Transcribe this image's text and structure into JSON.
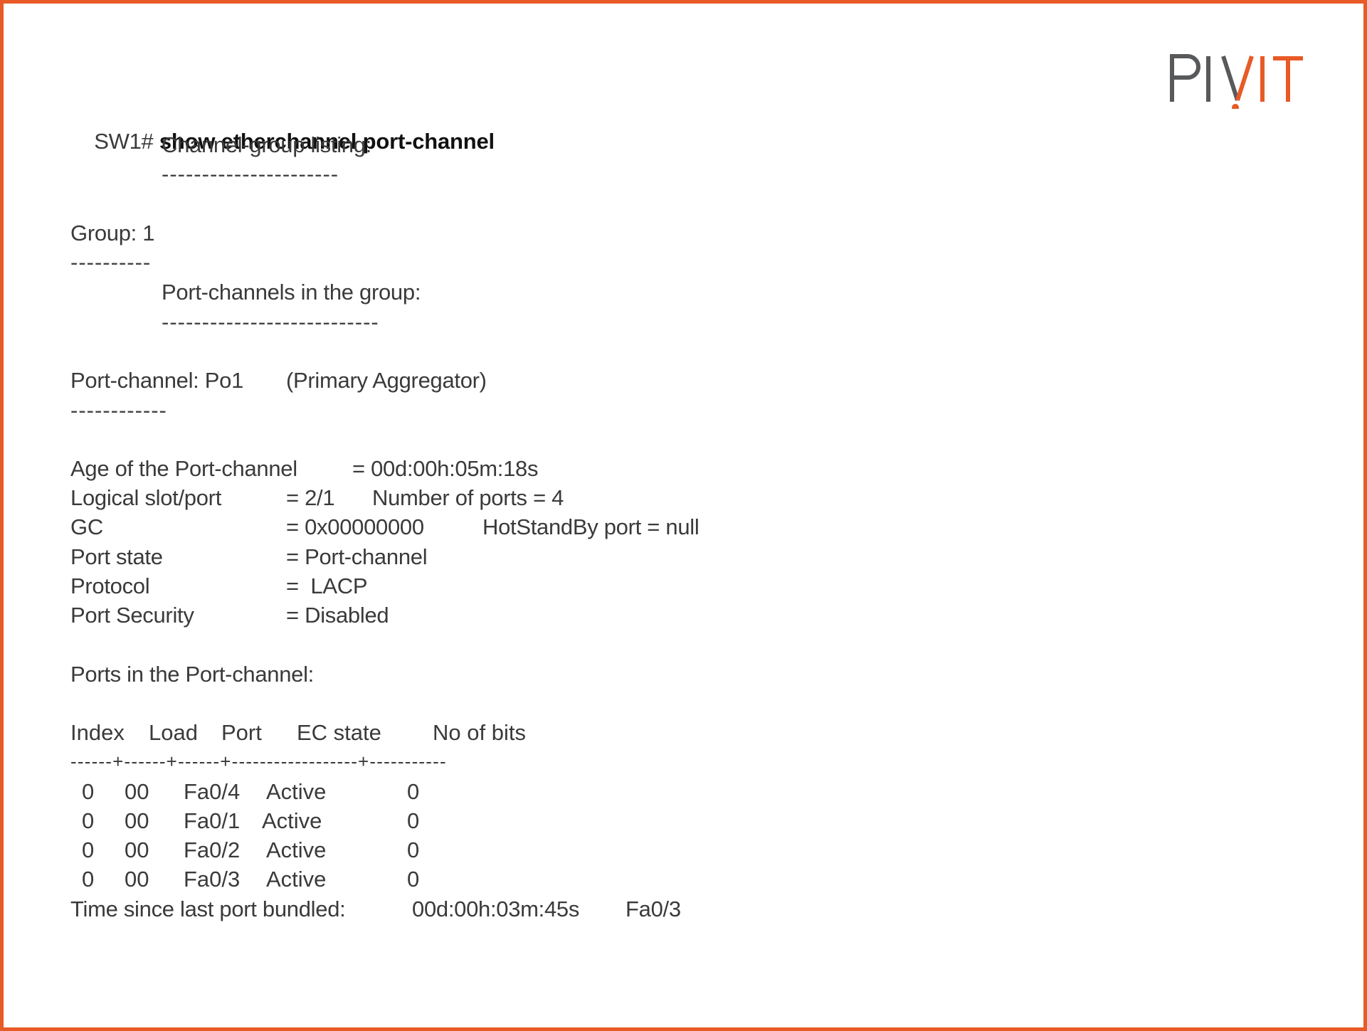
{
  "brand": {
    "logo_left": "PIV",
    "logo_right": "IT",
    "colors": {
      "gray": "#58595b",
      "orange": "#e85a26",
      "border": "#e85a26"
    }
  },
  "command": {
    "prompt": "SW1#",
    "text": "show etherchannel port-channel"
  },
  "listing": {
    "heading": "Channel-group listing:",
    "underline": "----------------------"
  },
  "group": {
    "label": "Group: 1",
    "underline": "----------",
    "sub_heading": "Port-channels in the group:",
    "sub_underline": "---------------------------"
  },
  "port_channel": {
    "label": "Port-channel: Po1",
    "note": "(Primary Aggregator)",
    "underline": "------------"
  },
  "properties": [
    {
      "key": "Age of the Port-channel",
      "value": "= 00d:00h:05m:18s",
      "extra": ""
    },
    {
      "key": "Logical slot/port",
      "value": "= 2/1",
      "extra": "Number of ports = 4"
    },
    {
      "key": "GC",
      "value": "= 0x00000000",
      "extra": "HotStandBy port = null"
    },
    {
      "key": "Port state",
      "value": "= Port-channel",
      "extra": ""
    },
    {
      "key": "Protocol",
      "value": "=  LACP",
      "extra": ""
    },
    {
      "key": "Port Security",
      "value": "= Disabled",
      "extra": ""
    }
  ],
  "ports": {
    "heading": "Ports in the Port-channel:",
    "columns": [
      "Index",
      "Load",
      "Port",
      "EC state",
      "No of bits"
    ],
    "separator": "------+------+------+------------------+-----------",
    "rows": [
      {
        "index": "0",
        "load": "00",
        "port": "Fa0/4",
        "ec_state": "Active",
        "bits": "0"
      },
      {
        "index": "0",
        "load": "00",
        "port": "Fa0/1",
        "ec_state": "Active",
        "bits": "0"
      },
      {
        "index": "0",
        "load": "00",
        "port": "Fa0/2",
        "ec_state": "Active",
        "bits": "0"
      },
      {
        "index": "0",
        "load": "00",
        "port": "Fa0/3",
        "ec_state": "Active",
        "bits": "0"
      }
    ]
  },
  "last_bundled": {
    "label": "Time since last port bundled:",
    "time": "00d:00h:03m:45s",
    "port": "Fa0/3"
  }
}
